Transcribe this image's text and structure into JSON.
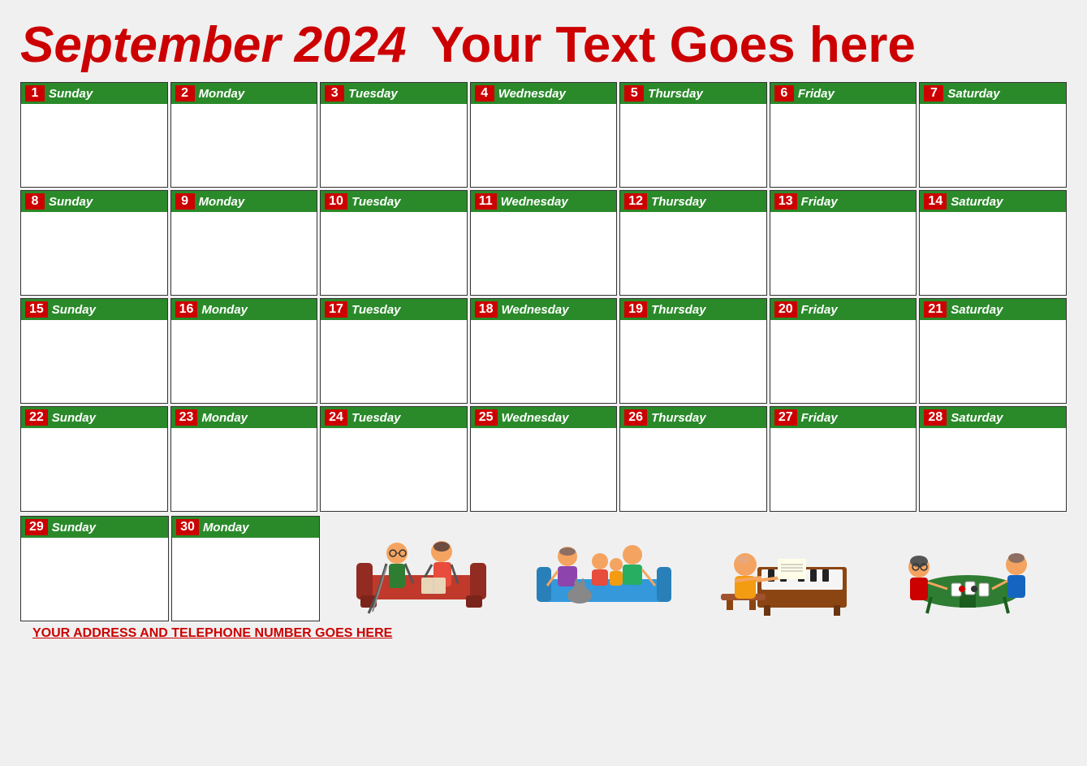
{
  "header": {
    "month_year": "September 2024",
    "tagline": "Your Text Goes here"
  },
  "footer": {
    "address": "YOUR ADDRESS AND TELEPHONE NUMBER GOES HERE"
  },
  "weeks": [
    [
      {
        "num": "1",
        "day": "Sunday"
      },
      {
        "num": "2",
        "day": "Monday"
      },
      {
        "num": "3",
        "day": "Tuesday"
      },
      {
        "num": "4",
        "day": "Wednesday"
      },
      {
        "num": "5",
        "day": "Thursday"
      },
      {
        "num": "6",
        "day": "Friday"
      },
      {
        "num": "7",
        "day": "Saturday"
      }
    ],
    [
      {
        "num": "8",
        "day": "Sunday"
      },
      {
        "num": "9",
        "day": "Monday"
      },
      {
        "num": "10",
        "day": "Tuesday"
      },
      {
        "num": "11",
        "day": "Wednesday"
      },
      {
        "num": "12",
        "day": "Thursday"
      },
      {
        "num": "13",
        "day": "Friday"
      },
      {
        "num": "14",
        "day": "Saturday"
      }
    ],
    [
      {
        "num": "15",
        "day": "Sunday"
      },
      {
        "num": "16",
        "day": "Monday"
      },
      {
        "num": "17",
        "day": "Tuesday"
      },
      {
        "num": "18",
        "day": "Wednesday"
      },
      {
        "num": "19",
        "day": "Thursday"
      },
      {
        "num": "20",
        "day": "Friday"
      },
      {
        "num": "21",
        "day": "Saturday"
      }
    ],
    [
      {
        "num": "22",
        "day": "Sunday"
      },
      {
        "num": "23",
        "day": "Monday"
      },
      {
        "num": "24",
        "day": "Tuesday"
      },
      {
        "num": "25",
        "day": "Wednesday"
      },
      {
        "num": "26",
        "day": "Thursday"
      },
      {
        "num": "27",
        "day": "Friday"
      },
      {
        "num": "28",
        "day": "Saturday"
      }
    ]
  ],
  "last_days": [
    {
      "num": "29",
      "day": "Sunday"
    },
    {
      "num": "30",
      "day": "Monday"
    }
  ]
}
